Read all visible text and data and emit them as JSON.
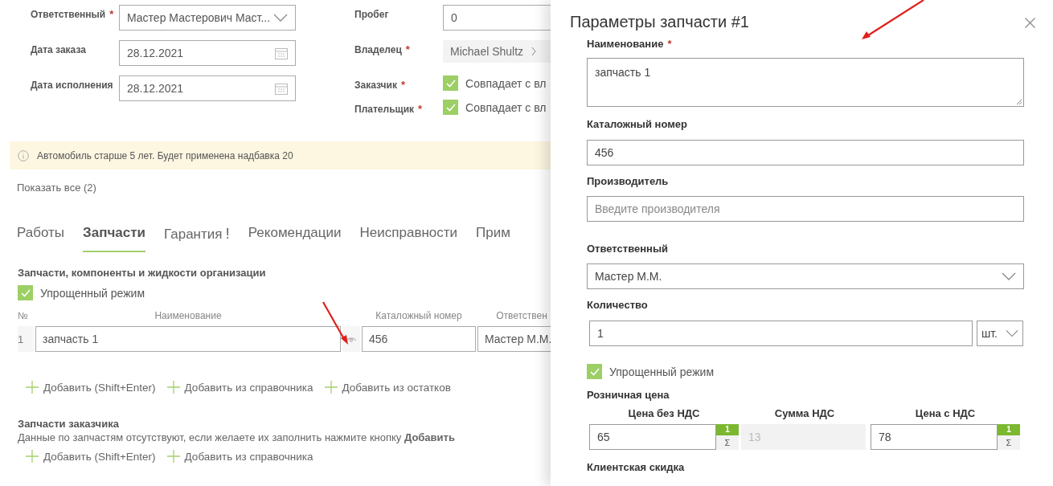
{
  "order": {
    "left_fields": [
      {
        "kind": "select",
        "label": "Ответственный",
        "required_mark": "*",
        "value": "Мастер Мастерович Маст..."
      },
      {
        "kind": "date",
        "label": "Дата заказа",
        "value": "28.12.2021"
      },
      {
        "kind": "date",
        "label": "Дата исполнения",
        "value": "28.12.2021"
      }
    ],
    "right_fields": [
      {
        "kind": "input",
        "label": "Пробег",
        "value": "0"
      },
      {
        "kind": "chip",
        "label": "Владелец",
        "required_mark": "*",
        "value": "Michael Shultz"
      },
      {
        "kind": "checkbox",
        "label": "Заказчик",
        "required_mark": "*",
        "value": "Совпадает с вл",
        "checked": true
      },
      {
        "kind": "checkbox",
        "label": "Плательщик",
        "required_mark": "*",
        "value": "Совпадает с вл",
        "checked": true
      }
    ]
  },
  "notice": "Автомобиль старше 5 лет. Будет применена надбавка 20",
  "show_all": "Показать все (2)",
  "tabs": [
    {
      "label": "Работы",
      "selected": false
    },
    {
      "label": "Запчасти",
      "selected": true
    },
    {
      "label": "Гарантия",
      "selected": false,
      "alert": "!"
    },
    {
      "label": "Рекомендации",
      "selected": false
    },
    {
      "label": "Неисправности",
      "selected": false
    },
    {
      "label": "Прим",
      "selected": false
    }
  ],
  "org_parts": {
    "title": "Запчасти, компоненты и жидкости организации",
    "simplified": {
      "label": "Упрощенный режим",
      "checked": true
    },
    "columns": [
      "№",
      "Наименование",
      "Каталожный номер",
      "Ответствен"
    ],
    "rows": [
      {
        "index": "1",
        "name": "запчасть 1",
        "catalog": "456",
        "responsible": "Мастер М.М."
      }
    ],
    "actions": [
      "Добавить (Shift+Enter)",
      "Добавить из справочника",
      "Добавить из остатков"
    ]
  },
  "customer_parts": {
    "title": "Запчасти заказчика",
    "message": "Данные по запчастям отсутствуют, если желаете их заполнить нажмите кнопку **Добавить**",
    "actions": [
      "Добавить (Shift+Enter)",
      "Добавить из справочника"
    ]
  },
  "panel": {
    "title": "Параметры запчасти #1",
    "name": {
      "label": "Наименование",
      "required_mark": "*",
      "value": "запчасть 1"
    },
    "catalog": {
      "label": "Каталожный номер",
      "value": "456"
    },
    "maker": {
      "label": "Производитель",
      "placeholder": "Введите производителя"
    },
    "responsible": {
      "label": "Ответственный",
      "value": "Мастер М.М."
    },
    "quantity": {
      "label": "Количество",
      "value": "1",
      "unit": "шт."
    },
    "simplified": {
      "label": "Упрощенный режим",
      "checked": true
    },
    "retail": {
      "label": "Розничная цена",
      "columns": [
        {
          "kind": "editable",
          "label": "Цена без НДС",
          "value": "65",
          "badge": "1",
          "sum": "Σ"
        },
        {
          "kind": "readonly",
          "label": "Сумма НДС",
          "value": "13",
          "disabled": true
        },
        {
          "kind": "editable",
          "label": "Цена с НДС",
          "value": "78",
          "badge": "1",
          "sum": "Σ"
        }
      ]
    },
    "next_label": "Клиентская скидка"
  }
}
